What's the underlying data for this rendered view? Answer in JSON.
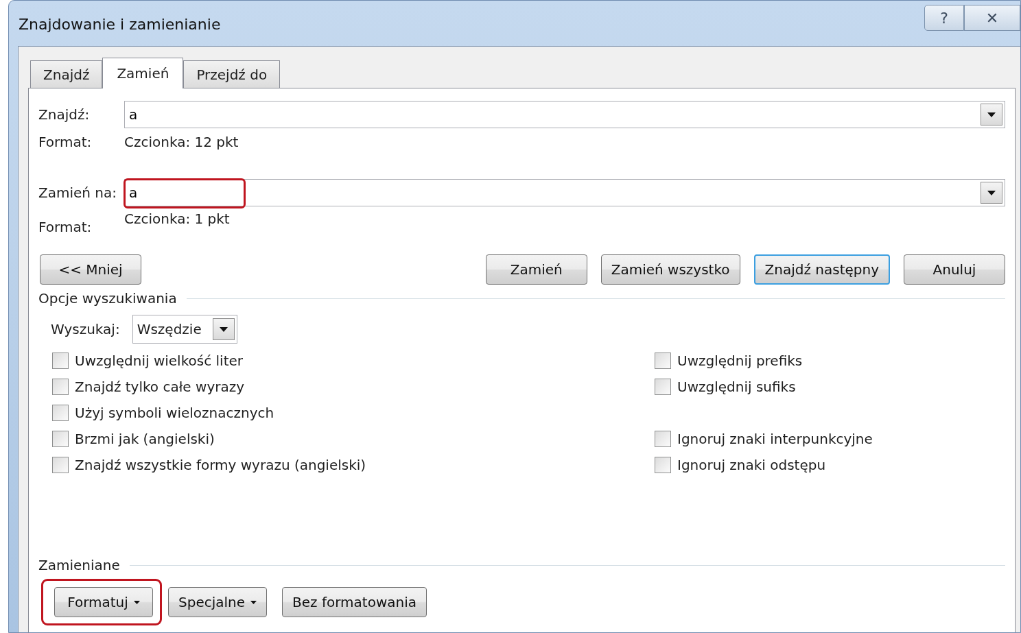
{
  "window": {
    "title": "Znajdowanie i zamienianie"
  },
  "title_buttons": [
    {
      "kind": "help",
      "label": "?"
    },
    {
      "kind": "close",
      "label": "✕"
    }
  ],
  "tabs": [
    {
      "label": "Znajdź",
      "selected": false
    },
    {
      "label": "Zamień",
      "selected": true
    },
    {
      "label": "Przejdź do",
      "selected": false
    }
  ],
  "find": {
    "label": "Znajdź:",
    "value": "a",
    "format_label": "Format:",
    "format_value": "Czcionka: 12 pkt"
  },
  "replace": {
    "label": "Zamień na:",
    "value": "a",
    "highlighted": true,
    "format_label": "Format:",
    "format_value": "Czcionka: 1 pkt"
  },
  "less_button": "<< Mniej",
  "action_buttons": [
    {
      "label": "Zamień",
      "default": false
    },
    {
      "label": "Zamień wszystko",
      "default": false
    },
    {
      "label": "Znajdź następny",
      "default": true
    },
    {
      "label": "Anuluj",
      "default": false
    }
  ],
  "search_options": {
    "title": "Opcje wyszukiwania",
    "search_label": "Wyszukaj:",
    "search_value": "Wszędzie",
    "left_options": [
      {
        "label": "Uwzględnij wielkość liter",
        "checked": false
      },
      {
        "label": "Znajdź tylko całe wyrazy",
        "checked": false
      },
      {
        "label": "Użyj symboli wieloznacznych",
        "checked": false
      },
      {
        "label": "Brzmi jak (angielski)",
        "checked": false
      },
      {
        "label": "Znajdź wszystkie formy wyrazu (angielski)",
        "checked": false
      }
    ],
    "right_option_groups": [
      [
        {
          "label": "Uwzględnij prefiks",
          "checked": false
        },
        {
          "label": "Uwzględnij sufiks",
          "checked": false
        }
      ],
      [
        {
          "label": "Ignoruj znaki interpunkcyjne",
          "checked": false
        },
        {
          "label": "Ignoruj znaki odstępu",
          "checked": false
        }
      ]
    ]
  },
  "replace_section": {
    "title": "Zamieniane",
    "buttons": [
      {
        "label": "Formatuj",
        "dropdown": true,
        "highlighted": true
      },
      {
        "label": "Specjalne",
        "dropdown": true,
        "highlighted": false
      },
      {
        "label": "Bez formatowania",
        "dropdown": false,
        "highlighted": false
      }
    ]
  }
}
